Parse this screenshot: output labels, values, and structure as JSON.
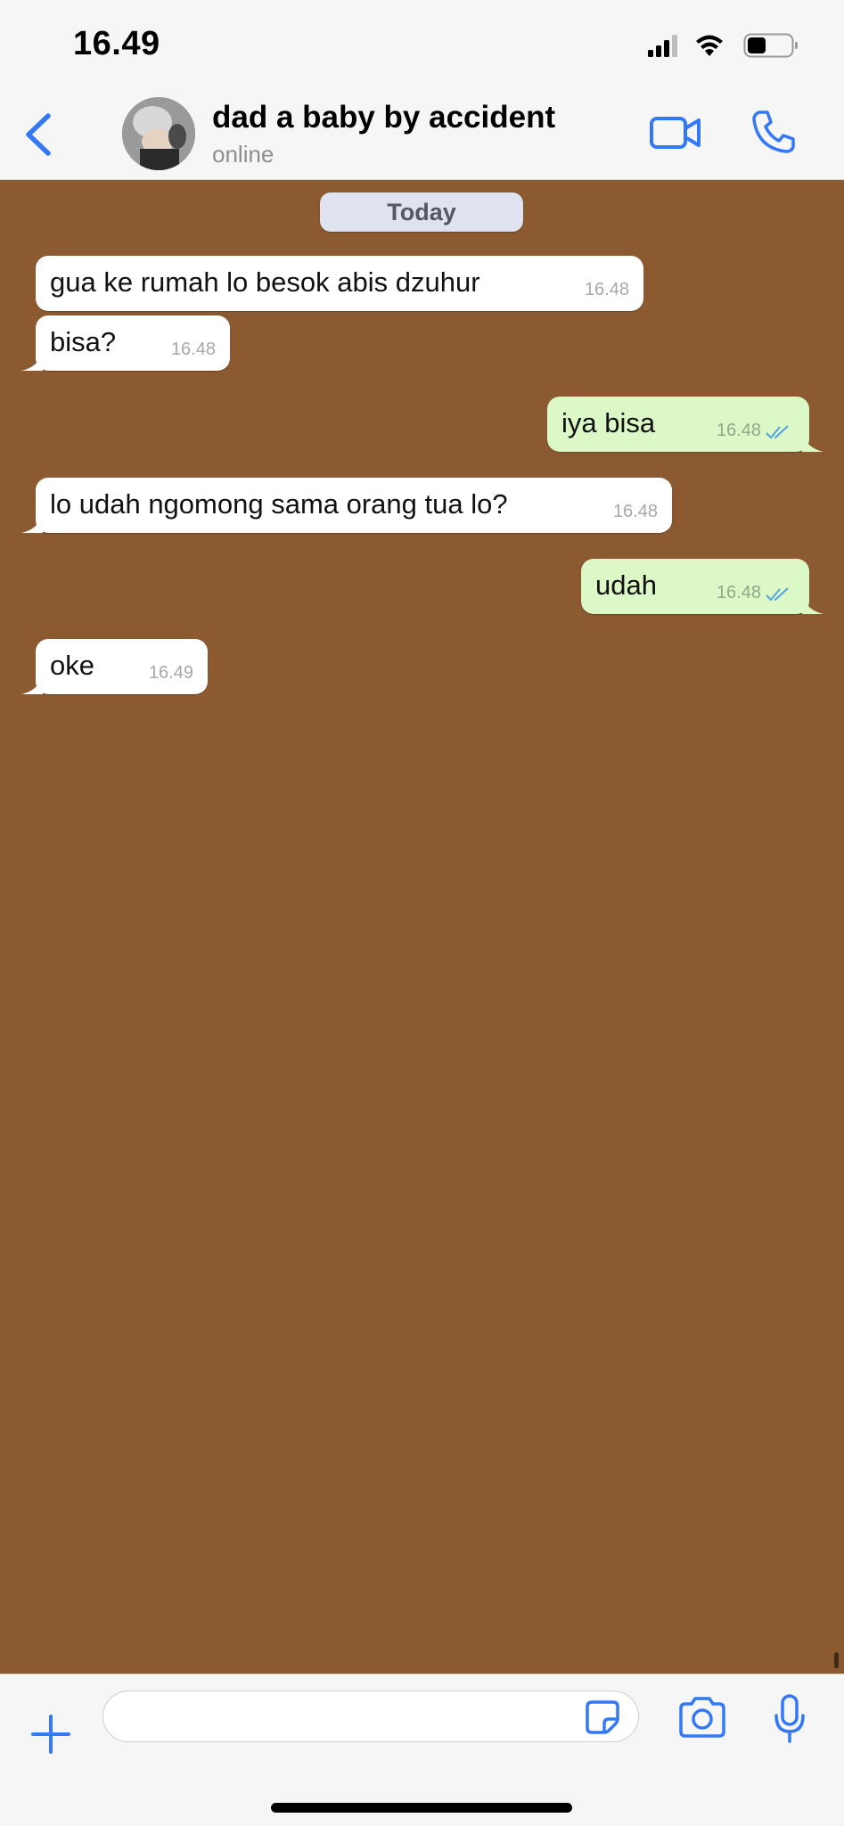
{
  "status_bar": {
    "time": "16.49"
  },
  "header": {
    "contact_name": "dad a baby by accident",
    "contact_status": "online"
  },
  "chat": {
    "date_label": "Today",
    "messages": [
      {
        "direction": "incoming",
        "text": "gua ke rumah lo besok abis dzuhur",
        "time": "16.48"
      },
      {
        "direction": "incoming",
        "text": "bisa?",
        "time": "16.48"
      },
      {
        "direction": "outgoing",
        "text": "iya bisa",
        "time": "16.48",
        "read": true
      },
      {
        "direction": "incoming",
        "text": "lo udah ngomong sama orang tua lo?",
        "time": "16.48"
      },
      {
        "direction": "outgoing",
        "text": "udah",
        "time": "16.48",
        "read": true
      },
      {
        "direction": "incoming",
        "text": "oke",
        "time": "16.49"
      }
    ]
  },
  "input": {
    "placeholder": "",
    "value": ""
  },
  "icons": {
    "back": "chevron-left-icon",
    "video": "video-camera-icon",
    "call": "phone-icon",
    "attach": "plus-icon",
    "sticker": "sticker-icon",
    "camera": "camera-icon",
    "mic": "microphone-icon"
  },
  "colors": {
    "accent": "#3478f6",
    "wallpaper": "#8b5a30",
    "incoming_bubble": "#ffffff",
    "outgoing_bubble": "#dcf8c6",
    "read_tick": "#4fa3e0"
  }
}
